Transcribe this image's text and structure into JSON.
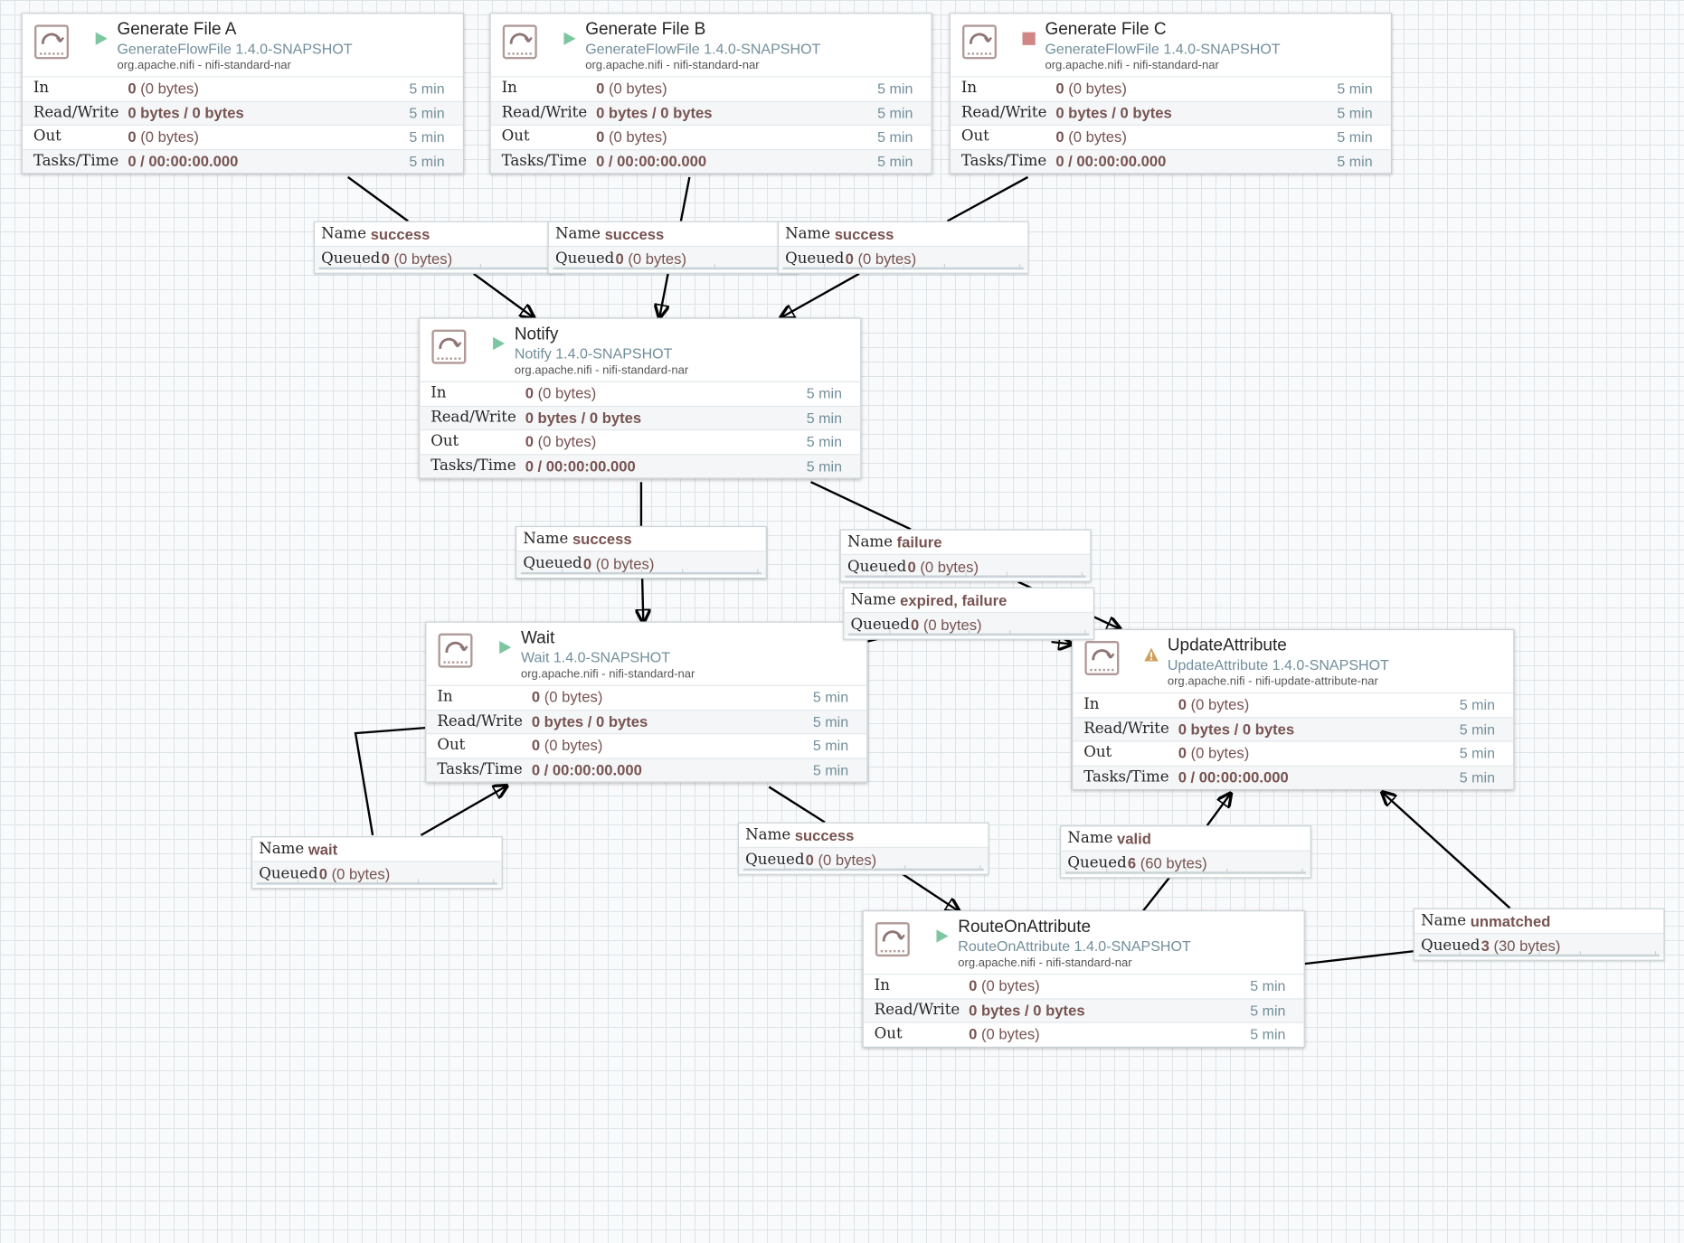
{
  "processors": [
    {
      "id": "gen-a",
      "name": "Generate File A",
      "type": "GenerateFlowFile 1.4.0-SNAPSHOT",
      "bundle": "org.apache.nifi - nifi-standard-nar",
      "state": "running",
      "state_icon": "play-icon",
      "stats": [
        {
          "label": "In",
          "value": "0",
          "sub": "(0 bytes)",
          "time": "5 min"
        },
        {
          "label": "Read/Write",
          "value": "0 bytes / 0 bytes",
          "sub": "",
          "time": "5 min"
        },
        {
          "label": "Out",
          "value": "0",
          "sub": "(0 bytes)",
          "time": "5 min"
        },
        {
          "label": "Tasks/Time",
          "value": "0 / 00:00:00.000",
          "sub": "",
          "time": "5 min"
        }
      ]
    },
    {
      "id": "gen-b",
      "name": "Generate File B",
      "type": "GenerateFlowFile 1.4.0-SNAPSHOT",
      "bundle": "org.apache.nifi - nifi-standard-nar",
      "state": "running",
      "state_icon": "play-icon",
      "stats": [
        {
          "label": "In",
          "value": "0",
          "sub": "(0 bytes)",
          "time": "5 min"
        },
        {
          "label": "Read/Write",
          "value": "0 bytes / 0 bytes",
          "sub": "",
          "time": "5 min"
        },
        {
          "label": "Out",
          "value": "0",
          "sub": "(0 bytes)",
          "time": "5 min"
        },
        {
          "label": "Tasks/Time",
          "value": "0 / 00:00:00.000",
          "sub": "",
          "time": "5 min"
        }
      ]
    },
    {
      "id": "gen-c",
      "name": "Generate File C",
      "type": "GenerateFlowFile 1.4.0-SNAPSHOT",
      "bundle": "org.apache.nifi - nifi-standard-nar",
      "state": "stopped",
      "state_icon": "stop-icon",
      "stats": [
        {
          "label": "In",
          "value": "0",
          "sub": "(0 bytes)",
          "time": "5 min"
        },
        {
          "label": "Read/Write",
          "value": "0 bytes / 0 bytes",
          "sub": "",
          "time": "5 min"
        },
        {
          "label": "Out",
          "value": "0",
          "sub": "(0 bytes)",
          "time": "5 min"
        },
        {
          "label": "Tasks/Time",
          "value": "0 / 00:00:00.000",
          "sub": "",
          "time": "5 min"
        }
      ]
    },
    {
      "id": "notify",
      "name": "Notify",
      "type": "Notify 1.4.0-SNAPSHOT",
      "bundle": "org.apache.nifi - nifi-standard-nar",
      "state": "running",
      "state_icon": "play-icon",
      "stats": [
        {
          "label": "In",
          "value": "0",
          "sub": "(0 bytes)",
          "time": "5 min"
        },
        {
          "label": "Read/Write",
          "value": "0 bytes / 0 bytes",
          "sub": "",
          "time": "5 min"
        },
        {
          "label": "Out",
          "value": "0",
          "sub": "(0 bytes)",
          "time": "5 min"
        },
        {
          "label": "Tasks/Time",
          "value": "0 / 00:00:00.000",
          "sub": "",
          "time": "5 min"
        }
      ]
    },
    {
      "id": "wait",
      "name": "Wait",
      "type": "Wait 1.4.0-SNAPSHOT",
      "bundle": "org.apache.nifi - nifi-standard-nar",
      "state": "running",
      "state_icon": "play-icon",
      "stats": [
        {
          "label": "In",
          "value": "0",
          "sub": "(0 bytes)",
          "time": "5 min"
        },
        {
          "label": "Read/Write",
          "value": "0 bytes / 0 bytes",
          "sub": "",
          "time": "5 min"
        },
        {
          "label": "Out",
          "value": "0",
          "sub": "(0 bytes)",
          "time": "5 min"
        },
        {
          "label": "Tasks/Time",
          "value": "0 / 00:00:00.000",
          "sub": "",
          "time": "5 min"
        }
      ]
    },
    {
      "id": "update",
      "name": "UpdateAttribute",
      "type": "UpdateAttribute 1.4.0-SNAPSHOT",
      "bundle": "org.apache.nifi - nifi-update-attribute-nar",
      "state": "invalid",
      "state_icon": "warning-icon",
      "stats": [
        {
          "label": "In",
          "value": "0",
          "sub": "(0 bytes)",
          "time": "5 min"
        },
        {
          "label": "Read/Write",
          "value": "0 bytes / 0 bytes",
          "sub": "",
          "time": "5 min"
        },
        {
          "label": "Out",
          "value": "0",
          "sub": "(0 bytes)",
          "time": "5 min"
        },
        {
          "label": "Tasks/Time",
          "value": "0 / 00:00:00.000",
          "sub": "",
          "time": "5 min"
        }
      ]
    },
    {
      "id": "route",
      "name": "RouteOnAttribute",
      "type": "RouteOnAttribute 1.4.0-SNAPSHOT",
      "bundle": "org.apache.nifi - nifi-standard-nar",
      "state": "running",
      "state_icon": "play-icon",
      "stats": [
        {
          "label": "In",
          "value": "0",
          "sub": "(0 bytes)",
          "time": "5 min"
        },
        {
          "label": "Read/Write",
          "value": "0 bytes / 0 bytes",
          "sub": "",
          "time": "5 min"
        },
        {
          "label": "Out",
          "value": "0",
          "sub": "(0 bytes)",
          "time": "5 min"
        }
      ]
    }
  ],
  "connections": [
    {
      "id": "c-a",
      "name": "success",
      "queued_count": "0",
      "queued_size": "(0 bytes)"
    },
    {
      "id": "c-b",
      "name": "success",
      "queued_count": "0",
      "queued_size": "(0 bytes)"
    },
    {
      "id": "c-c",
      "name": "success",
      "queued_count": "0",
      "queued_size": "(0 bytes)"
    },
    {
      "id": "c-notify-success",
      "name": "success",
      "queued_count": "0",
      "queued_size": "(0 bytes)"
    },
    {
      "id": "c-notify-failure",
      "name": "failure",
      "queued_count": "0",
      "queued_size": "(0 bytes)"
    },
    {
      "id": "c-wait-expired",
      "name": "expired, failure",
      "queued_count": "0",
      "queued_size": "(0 bytes)"
    },
    {
      "id": "c-wait-wait",
      "name": "wait",
      "queued_count": "0",
      "queued_size": "(0 bytes)"
    },
    {
      "id": "c-wait-success",
      "name": "success",
      "queued_count": "0",
      "queued_size": "(0 bytes)"
    },
    {
      "id": "c-valid",
      "name": "valid",
      "queued_count": "6",
      "queued_size": "(60 bytes)"
    },
    {
      "id": "c-unmatched",
      "name": "unmatched",
      "queued_count": "3",
      "queued_size": "(30 bytes)"
    }
  ],
  "labels": {
    "name": "Name",
    "queued": "Queued"
  },
  "colors": {
    "running": "#7dc7a0",
    "stopped": "#d18686",
    "invalid": "#cf9f5d",
    "value": "#775351",
    "type": "#728e9b"
  }
}
